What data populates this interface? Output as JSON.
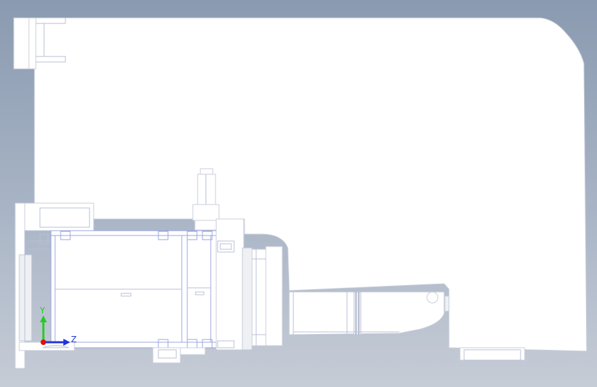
{
  "viewport": {
    "background_top": "#8a9ab0",
    "background_bottom": "#c6ccd6",
    "model_fill": "#ffffff",
    "edge_color": "#b7bfd6"
  },
  "triad": {
    "y_label": "Y",
    "z_label": "Z",
    "y_color": "#22cc22",
    "z_color": "#2233dd",
    "x_color": "#dd1111"
  }
}
